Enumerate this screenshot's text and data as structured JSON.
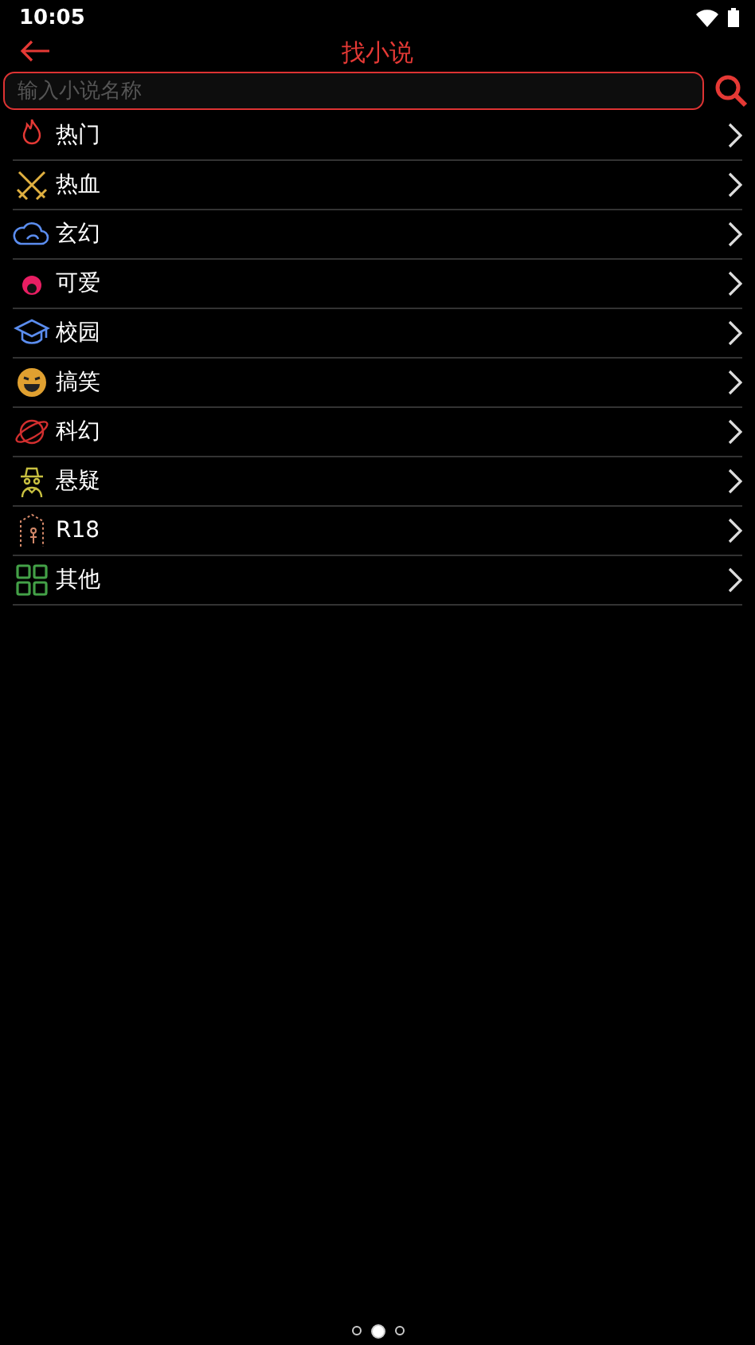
{
  "status_bar": {
    "time": "10:05"
  },
  "header": {
    "title": "找小说"
  },
  "search": {
    "placeholder": "输入小说名称"
  },
  "categories": [
    {
      "label": "热门"
    },
    {
      "label": "热血"
    },
    {
      "label": "玄幻"
    },
    {
      "label": "可爱"
    },
    {
      "label": "校园"
    },
    {
      "label": "搞笑"
    },
    {
      "label": "科幻"
    },
    {
      "label": "悬疑"
    },
    {
      "label": "R18"
    },
    {
      "label": "其他"
    }
  ],
  "pager": [
    {
      "selected": false
    },
    {
      "selected": true
    },
    {
      "selected": false
    }
  ]
}
